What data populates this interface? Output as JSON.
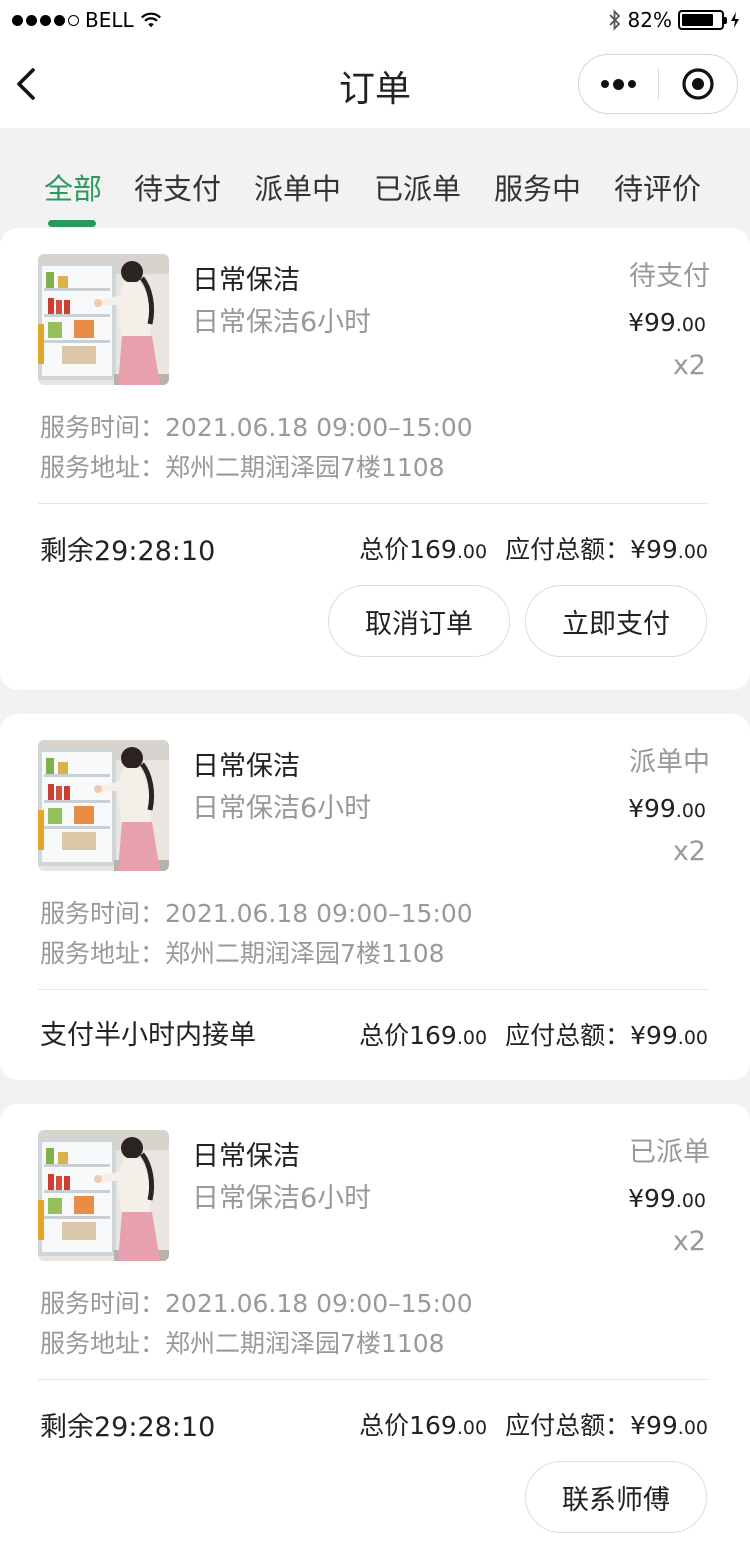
{
  "status_bar": {
    "carrier": "BELL",
    "battery": "82%",
    "battery_level": 0.82
  },
  "nav": {
    "title": "订单"
  },
  "tabs": [
    {
      "label": "全部",
      "active": true
    },
    {
      "label": "待支付"
    },
    {
      "label": "派单中"
    },
    {
      "label": "已派单"
    },
    {
      "label": "服务中"
    },
    {
      "label": "待评价"
    }
  ],
  "orders": [
    {
      "service": "日常保洁",
      "desc": "日常保洁6小时",
      "status": "待支付",
      "price_int": "¥99",
      "price_dec": ".00",
      "qty": "x2",
      "time_label": "服务时间：",
      "time_value": "2021.06.18 09:00–15:00",
      "addr_label": "服务地址：",
      "addr_value": "郑州二期润泽园7楼1108",
      "footer_left": "剩余29:28:10",
      "total_int": "总价169",
      "total_dec": ".00",
      "pay_int": "应付总额：¥99",
      "pay_dec": ".00",
      "buttons": [
        "取消订单",
        "立即支付"
      ]
    },
    {
      "service": "日常保洁",
      "desc": "日常保洁6小时",
      "status": "派单中",
      "price_int": "¥99",
      "price_dec": ".00",
      "qty": "x2",
      "time_label": "服务时间：",
      "time_value": "2021.06.18 09:00–15:00",
      "addr_label": "服务地址：",
      "addr_value": "郑州二期润泽园7楼1108",
      "footer_left": "支付半小时内接单",
      "total_int": "总价169",
      "total_dec": ".00",
      "pay_int": "应付总额：¥99",
      "pay_dec": ".00",
      "buttons": []
    },
    {
      "service": "日常保洁",
      "desc": "日常保洁6小时",
      "status": "已派单",
      "price_int": "¥99",
      "price_dec": ".00",
      "qty": "x2",
      "time_label": "服务时间：",
      "time_value": "2021.06.18 09:00–15:00",
      "addr_label": "服务地址：",
      "addr_value": "郑州二期润泽园7楼1108",
      "footer_left": "剩余29:28:10",
      "total_int": "总价169",
      "total_dec": ".00",
      "pay_int": "应付总额：¥99",
      "pay_dec": ".00",
      "buttons": [
        "联系师傅"
      ]
    }
  ],
  "colors": {
    "accent": "#2a9a5c",
    "muted": "#999999",
    "background": "#f2f2f2"
  }
}
